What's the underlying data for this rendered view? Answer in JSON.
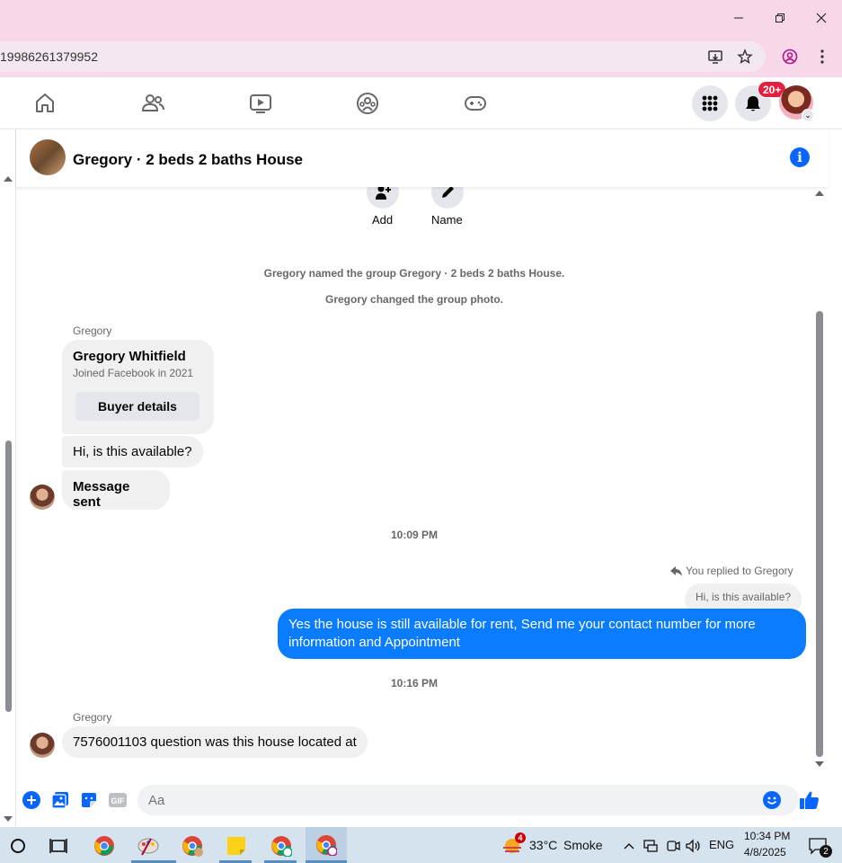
{
  "browser": {
    "url": "19986261379952"
  },
  "nav": {
    "notification_badge": "20+"
  },
  "chat": {
    "title": "Gregory · 2 beds 2 baths House",
    "actions": [
      {
        "label": "Add",
        "icon": "add-person-icon"
      },
      {
        "label": "Name",
        "icon": "pencil-icon"
      }
    ],
    "system_messages": [
      "Gregory named the group Gregory · 2 beds 2 baths House.",
      "Gregory changed the group photo."
    ],
    "buyer_card": {
      "sender": "Gregory",
      "name": "Gregory Whitfield",
      "joined": "Joined Facebook in 2021",
      "button": "Buyer details"
    },
    "incoming_1": "Hi, is this available?",
    "incoming_2": "Message sent",
    "timestamp_1": "10:09 PM",
    "reply_note": "You replied to Gregory",
    "reply_quote": "Hi, is this available?",
    "outgoing_1": "Yes the house is still available for rent, Send me your contact number for more information and Appointment",
    "timestamp_2": "10:16 PM",
    "sender_2": "Gregory",
    "incoming_3": "7576001103 question was this house located at"
  },
  "composer": {
    "placeholder": "Aa"
  },
  "taskbar": {
    "weather_temp": "33°C",
    "weather_desc": "Smoke",
    "weather_badge": "4",
    "language": "ENG",
    "time": "10:34 PM",
    "date": "4/8/2025",
    "notifications": "2"
  },
  "colors": {
    "accent": "#0866ff",
    "outgoing_bubble": "#0a7cff",
    "badge": "#e41e3f",
    "titlebar": "#f7d7e8"
  }
}
